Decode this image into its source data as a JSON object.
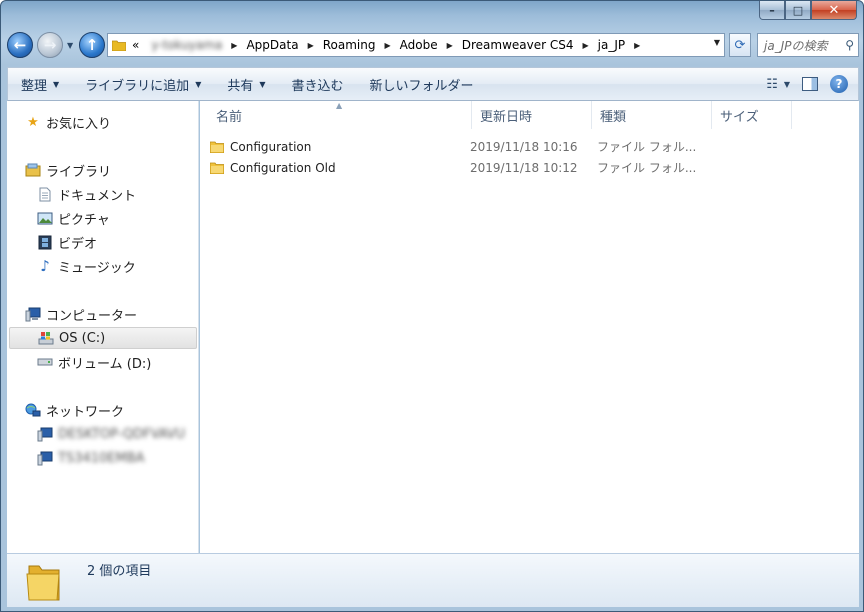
{
  "window": {
    "caption_buttons": {
      "minimize": "–",
      "maximize": "□",
      "close": "✕"
    }
  },
  "nav": {
    "back_icon": "arrow-left-icon",
    "forward_icon": "arrow-right-icon",
    "up_icon": "arrow-up-icon"
  },
  "address": {
    "overflow": "«",
    "user": "y-tokuyama",
    "crumbs": [
      "AppData",
      "Roaming",
      "Adobe",
      "Dreamweaver CS4",
      "ja_JP"
    ]
  },
  "search": {
    "placeholder": "ja_JPの検索"
  },
  "toolbar": {
    "organize": "整理",
    "add_to_library": "ライブラリに追加",
    "share": "共有",
    "burn": "書き込む",
    "new_folder": "新しいフォルダー"
  },
  "navpane": {
    "favorites": "お気に入り",
    "libraries": "ライブラリ",
    "documents": "ドキュメント",
    "pictures": "ピクチャ",
    "videos": "ビデオ",
    "music": "ミュージック",
    "computer": "コンピューター",
    "drive_c": "OS (C:)",
    "drive_d": "ボリューム (D:)",
    "network": "ネットワーク",
    "net_host1": "DESKTOP-QDFVAVU",
    "net_host2": "TS3410EMBA"
  },
  "columns": {
    "name": "名前",
    "modified": "更新日時",
    "type": "種類",
    "size": "サイズ"
  },
  "files": [
    {
      "name": "Configuration",
      "modified": "2019/11/18 10:16",
      "type": "ファイル フォル..."
    },
    {
      "name": "Configuration Old",
      "modified": "2019/11/18 10:12",
      "type": "ファイル フォル..."
    }
  ],
  "details": {
    "count": "2 個の項目"
  },
  "colors": {
    "accent": "#1e395b",
    "folder": "#f2c94c"
  }
}
